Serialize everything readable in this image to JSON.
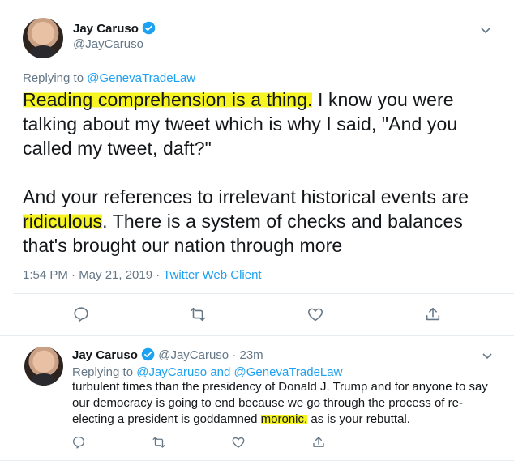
{
  "main_tweet": {
    "name": "Jay Caruso",
    "handle": "@JayCaruso",
    "replying_prefix": "Replying to",
    "replying_to": "@GenevaTradeLaw",
    "text": {
      "line1_hl": "Reading comprehension is a thing.",
      "line1_rest": " I know you were",
      "line2": "talking about my tweet which is why I said, \"And you",
      "line3": "called my tweet, daft?\"",
      "line4": "And your references to irrelevant historical events are",
      "line5_hl": "ridiculous",
      "line5_rest": ". There is a system of checks and balances",
      "line6": "that's brought our nation through more"
    },
    "timestamp": "1:54 PM · May 21, 2019 · ",
    "client": "Twitter Web Client"
  },
  "reply_tweet": {
    "name": "Jay Caruso",
    "handle": "@JayCaruso",
    "time": "· 23m",
    "replying_prefix": "Replying to",
    "replying_to_1": "@JayCaruso",
    "and_word": "and",
    "replying_to_2": "@GenevaTradeLaw",
    "text": {
      "line1": "turbulent times than the presidency of Donald J. Trump and for anyone to say",
      "line2": "our democracy is going to end because we go through the process of re-",
      "line3_pre": "electing a president is goddamned ",
      "line3_hl": "moronic,",
      "line3_post": " as is your rebuttal."
    }
  },
  "icons": {
    "verified": "verified-badge-icon",
    "menu": "chevron-down-icon",
    "reply": "reply-icon",
    "retweet": "retweet-icon",
    "like": "heart-icon",
    "share": "share-icon"
  },
  "colors": {
    "accent": "#1da1f2",
    "muted": "#657786",
    "highlight": "#f6f421"
  }
}
